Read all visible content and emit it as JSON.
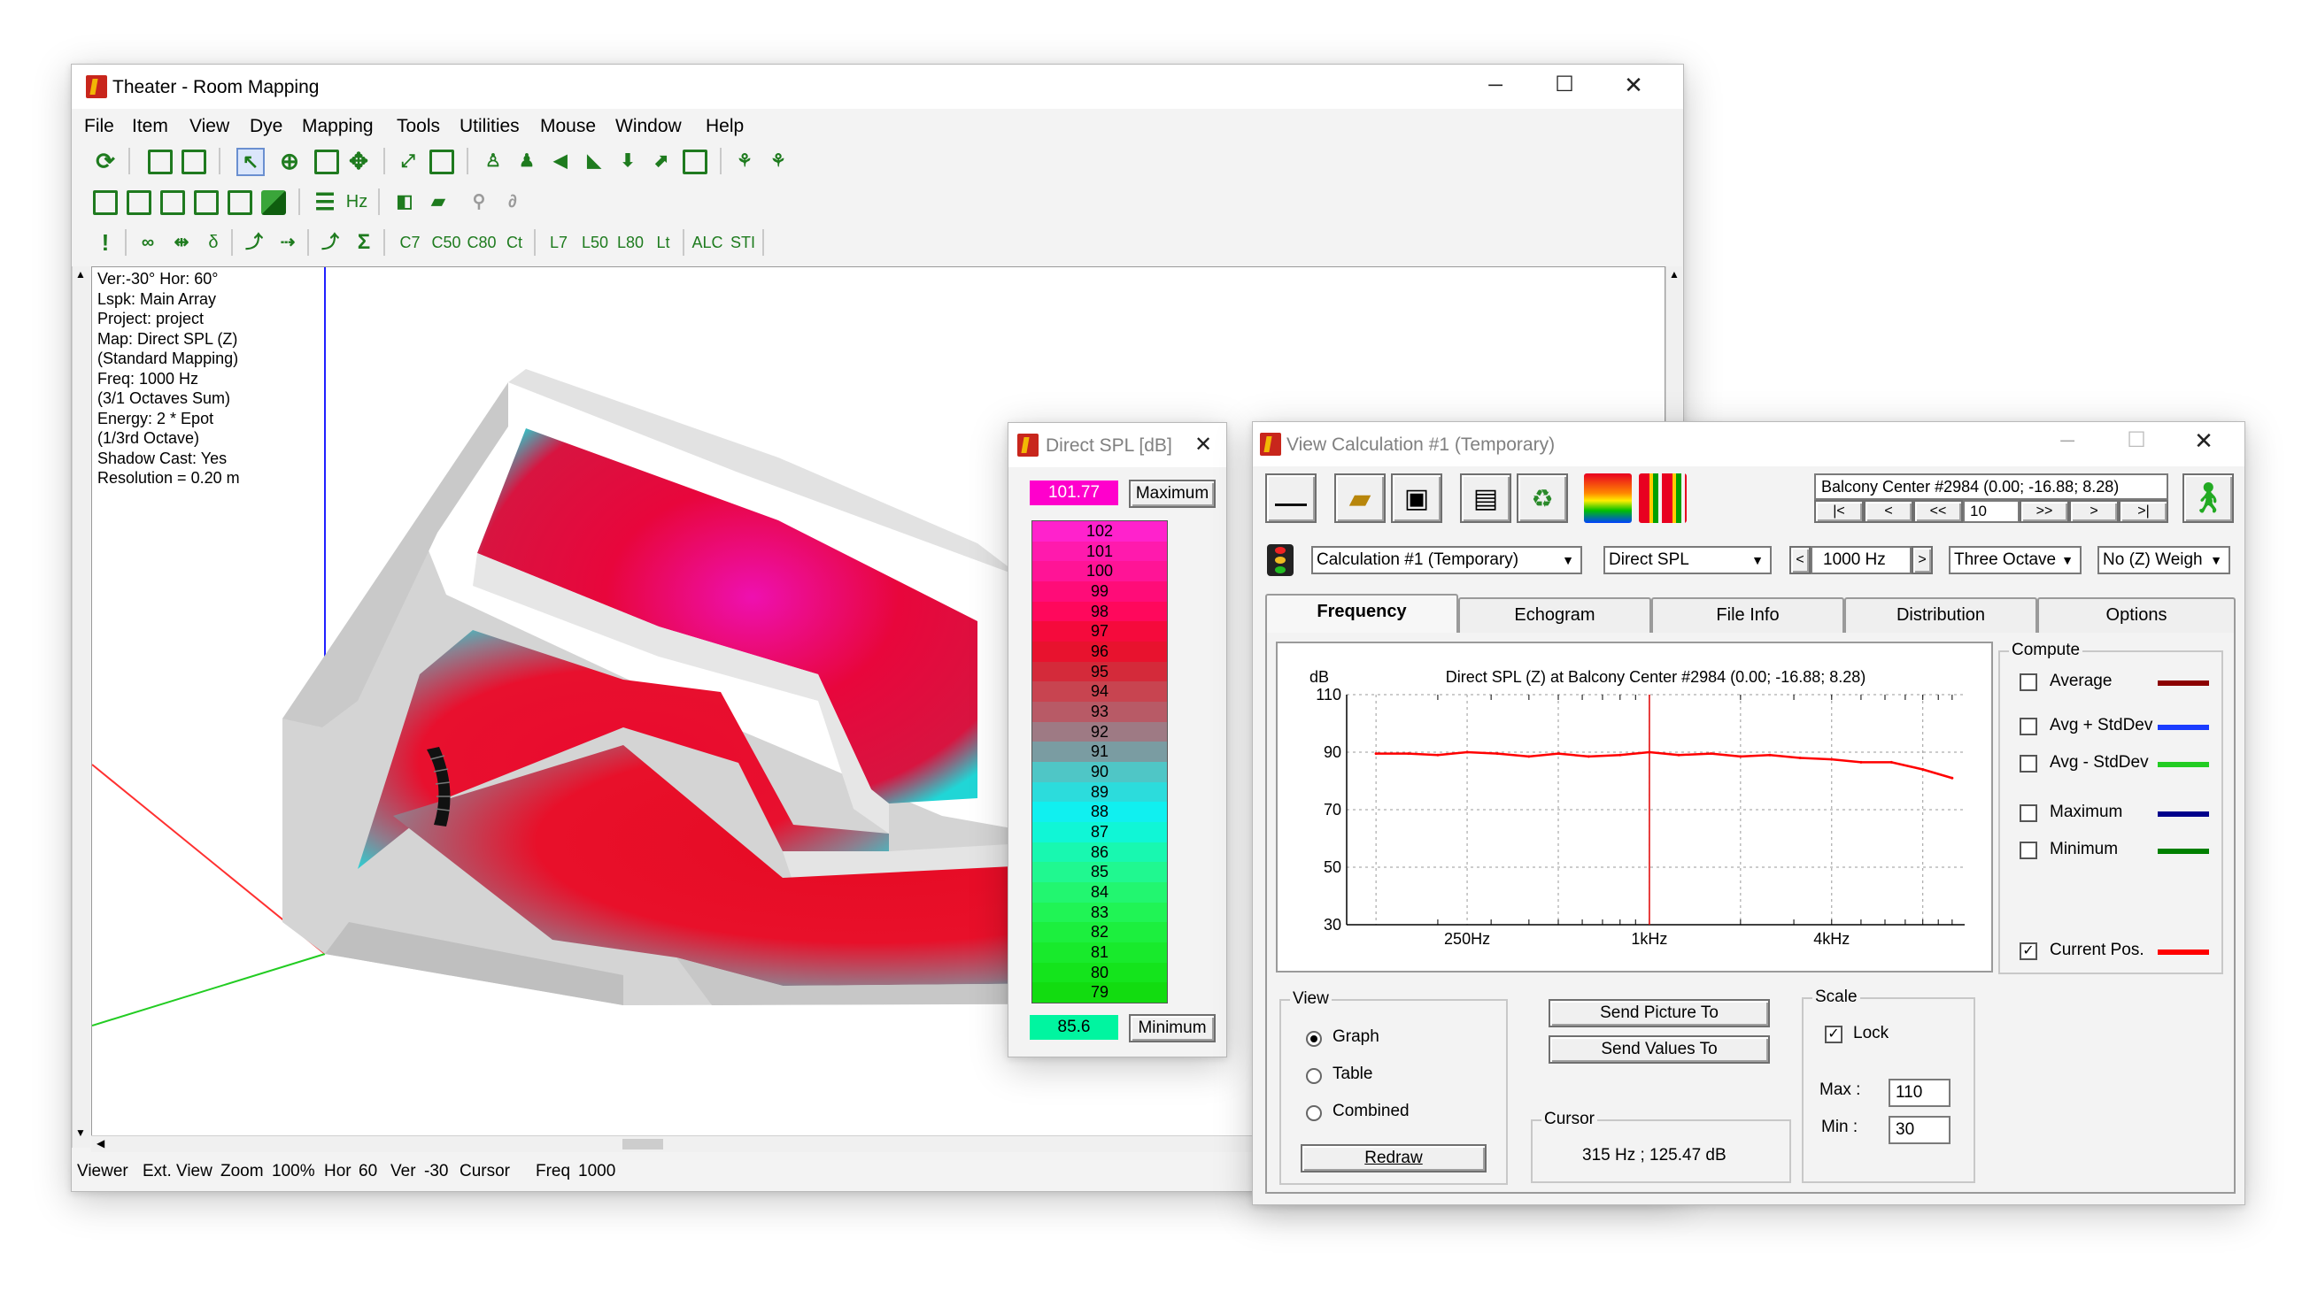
{
  "main": {
    "title": "Theater - Room Mapping",
    "menu": [
      "File",
      "Item",
      "View",
      "Dye",
      "Mapping",
      "Tools",
      "Utilities",
      "Mouse",
      "Window",
      "Help"
    ],
    "toolbar3": [
      "C7",
      "C50",
      "C80",
      "Ct",
      "L7",
      "L50",
      "L80",
      "Lt",
      "ALC",
      "STI"
    ],
    "toolbar2_hz": "Hz",
    "info": [
      "Ver:-30°  Hor: 60°",
      "Lspk: Main Array",
      "Project: project",
      "Map: Direct SPL (Z)",
      "(Standard Mapping)",
      "Freq: 1000 Hz",
      "(3/1 Octaves Sum)",
      "Energy: 2 * Epot",
      "(1/3rd Octave)",
      "Shadow Cast: Yes",
      "Resolution =   0.20 m"
    ],
    "status": {
      "viewer": "Viewer",
      "ext_view": "Ext. View",
      "zoom_label": "Zoom",
      "zoom": "100%",
      "hor_label": "Hor",
      "hor": "60",
      "ver_label": "Ver",
      "ver": "-30",
      "cursor_label": "Cursor",
      "freq_label": "Freq",
      "freq": "1000"
    }
  },
  "legend": {
    "title": "Direct SPL [dB]",
    "max_value": "101.77",
    "max_button": "Maximum",
    "min_value": "85.6",
    "min_button": "Minimum",
    "levels": [
      "102",
      "101",
      "100",
      "99",
      "98",
      "97",
      "96",
      "95",
      "94",
      "93",
      "92",
      "91",
      "90",
      "89",
      "88",
      "87",
      "86",
      "85",
      "84",
      "83",
      "82",
      "81",
      "80",
      "79"
    ],
    "colors": [
      "#ff22cc",
      "#ff1aad",
      "#ff1496",
      "#ff0c78",
      "#ff085c",
      "#f50a3c",
      "#e8122e",
      "#d42a3a",
      "#c84450",
      "#b85a66",
      "#9e7a84",
      "#7a9ca2",
      "#4fc6c6",
      "#2cdcdc",
      "#10f0f0",
      "#10f6d6",
      "#18f8b0",
      "#20f890",
      "#22f670",
      "#20f455",
      "#1cef3e",
      "#18ea2c",
      "#14e41c",
      "#12dc10"
    ],
    "max_color": "#ff00cc",
    "min_color": "#00f5a0"
  },
  "calc": {
    "title": "View Calculation #1 (Temporary)",
    "position": "Balcony Center #2984  (0.00; -16.88; 8.28)",
    "nav": [
      "|<",
      "<",
      "<<",
      "10",
      ">>",
      ">",
      ">|"
    ],
    "calc_select": "Calculation #1 (Temporary)",
    "param_select": "Direct SPL",
    "freq": "1000 Hz",
    "band_select": "Three Octave",
    "weight_select": "No (Z) Weigh",
    "tabs": [
      "Frequency",
      "Echogram",
      "File Info",
      "Distribution",
      "Options"
    ],
    "compute_label": "Compute",
    "compute": [
      {
        "label": "Average",
        "checked": false,
        "color": "#8b0000"
      },
      {
        "label": "Avg + StdDev",
        "checked": false,
        "color": "#1a3cff"
      },
      {
        "label": "Avg - StdDev",
        "checked": false,
        "color": "#22cc22"
      },
      {
        "label": "Maximum",
        "checked": false,
        "color": "#00008b"
      },
      {
        "label": "Minimum",
        "checked": false,
        "color": "#008000"
      },
      {
        "label": "Current Pos.",
        "checked": true,
        "color": "#ff0000"
      }
    ],
    "view_label": "View",
    "view_options": [
      {
        "label": "Graph",
        "on": true
      },
      {
        "label": "Table",
        "on": false
      },
      {
        "label": "Combined",
        "on": false
      }
    ],
    "redraw": "Redraw",
    "send_picture": "Send Picture To",
    "send_values": "Send Values To",
    "cursor_label": "Cursor",
    "cursor_value": "315 Hz ; 125.47 dB",
    "scale_label": "Scale",
    "lock_label": "Lock",
    "lock": true,
    "max_label": "Max :",
    "max": "110",
    "min_label": "Min :",
    "min": "30",
    "check_mark": "✓"
  },
  "chart_data": {
    "type": "line",
    "title": "Direct SPL (Z) at Balcony Center #2984  (0.00; -16.88; 8.28)",
    "ylabel": "dB",
    "ylim": [
      30,
      110
    ],
    "yticks": [
      "110",
      "90",
      "70",
      "50",
      "30"
    ],
    "xscale": "log",
    "xlim": [
      100,
      11000
    ],
    "xticks": [
      "250Hz",
      "1kHz",
      "4kHz"
    ],
    "series": [
      {
        "color": "#ff0000",
        "x": [
          125,
          160,
          200,
          250,
          315,
          400,
          500,
          630,
          800,
          1000,
          1250,
          1600,
          2000,
          2500,
          3150,
          4000,
          5000,
          6300,
          8000,
          10000
        ],
        "y": [
          89.5,
          89.5,
          89.0,
          90.0,
          89.5,
          88.5,
          89.5,
          88.5,
          89.0,
          90.0,
          89.0,
          89.5,
          88.5,
          89.0,
          88.0,
          87.5,
          86.5,
          86.5,
          84.0,
          81.0
        ]
      }
    ],
    "cursor_x": 1000,
    "grid": true
  }
}
